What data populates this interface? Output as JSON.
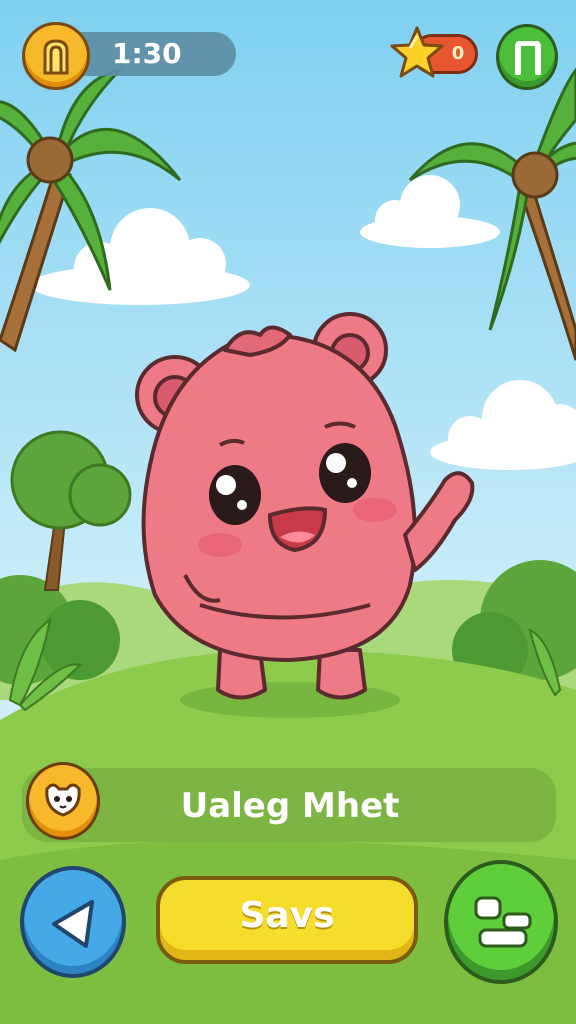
{
  "hud": {
    "timer": "1:30",
    "score_badge": "0",
    "coin_icon": "coin-hand-icon",
    "star_icon": "star-icon",
    "pause_icon": "pause-icon"
  },
  "pet_panel": {
    "name_text": "Ualeg Mhet",
    "pet_icon": "pet-face-icon"
  },
  "controls": {
    "back_icon": "back-arrow-icon",
    "save_label": "Savs",
    "menu_icon": "menu-icon"
  },
  "colors": {
    "sky": "#7fd0f1",
    "grass": "#8ccb4c",
    "pet_body": "#ee7a86",
    "save_button": "#f6dc2b",
    "back_button": "#45a9e8",
    "menu_button": "#5ecf3a",
    "coin_button": "#f7b82b",
    "score_badge": "#e8562f"
  }
}
